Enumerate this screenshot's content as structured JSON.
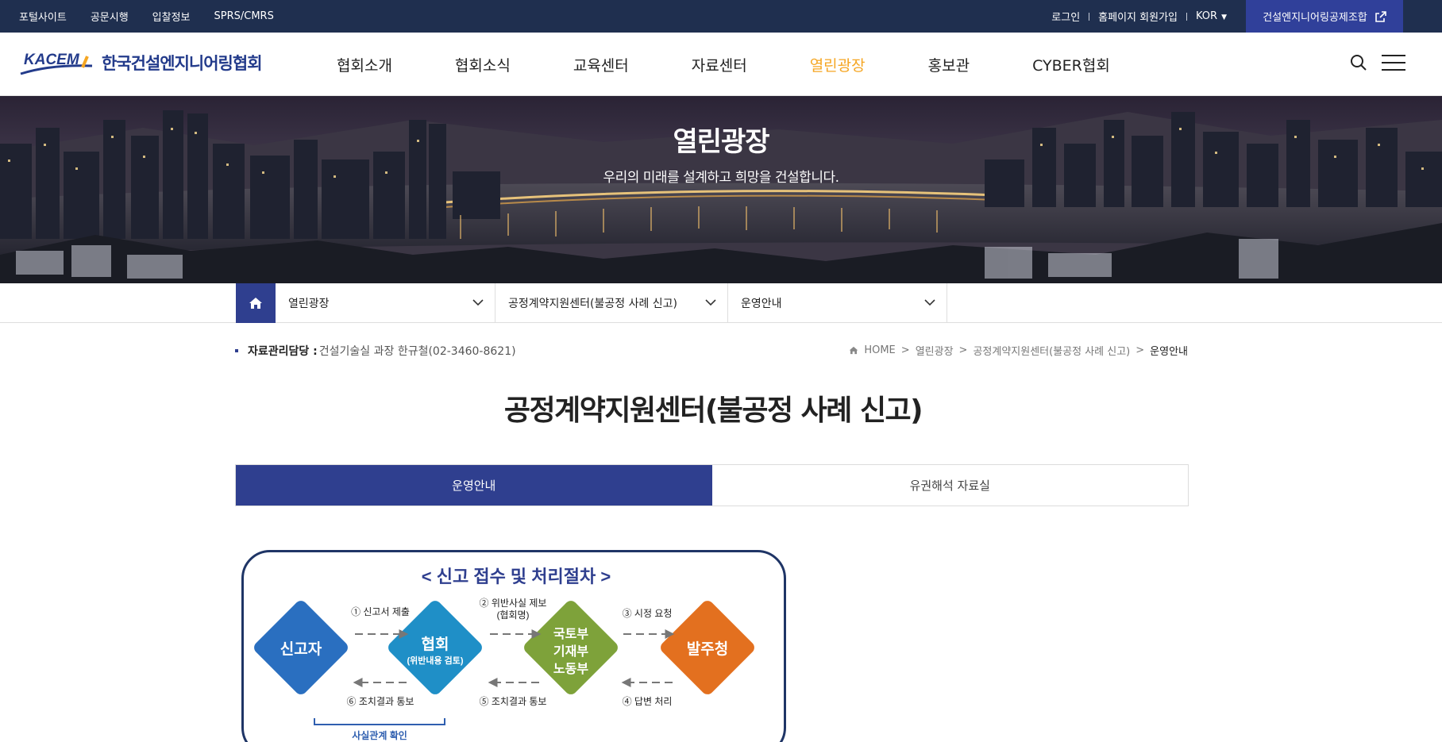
{
  "topbar": {
    "links": [
      "포털사이트",
      "공문시행",
      "입찰정보",
      "SPRS/CMRS"
    ],
    "login": "로그인",
    "join": "홈페이지 회원가입",
    "language": "KOR",
    "cta_label": "건설엔지니어링공제조합"
  },
  "header": {
    "logo_text": "KACEM",
    "logo_name": "한국건설엔지니어링협회",
    "nav": [
      "협회소개",
      "협회소식",
      "교육센터",
      "자료센터",
      "열린광장",
      "홍보관",
      "CYBER협회"
    ],
    "active_nav": "열린광장"
  },
  "hero": {
    "title": "열린광장",
    "subtitle": "우리의 미래를 설계하고 희망을 건설합니다."
  },
  "location": {
    "dropdowns": [
      "열린광장",
      "공정계약지원센터(불공정 사례 신고)",
      "운영안내"
    ]
  },
  "content": {
    "manager_label": "자료관리담당 :",
    "manager_value": "건설기술실 과장 한규철(02-3460-8621)",
    "breadcrumb": [
      "HOME",
      "열린광장",
      "공정계약지원센터(불공정 사례 신고)",
      "운영안내"
    ],
    "page_title": "공정계약지원센터(불공정 사례 신고)",
    "tabs": [
      "운영안내",
      "유권해석 자료실"
    ],
    "active_tab": 0
  },
  "diagram": {
    "title": "< 신고 접수 및 처리절차 >",
    "nodes": [
      {
        "label": "신고자",
        "color": "#2a6fc0"
      },
      {
        "label": "협회",
        "sub": "(위반내용 검토)",
        "color": "#1f8fc7"
      },
      {
        "label_lines": [
          "국토부",
          "기재부",
          "노동부"
        ],
        "color": "#7ea23a"
      },
      {
        "label": "발주청",
        "color": "#e3701f"
      }
    ],
    "forward_steps": [
      "① 신고서 제출",
      "② 위반사실 제보",
      "(협회명)",
      "③ 시정 요청"
    ],
    "backward_steps": [
      "⑥ 조치결과 통보",
      "⑤ 조치결과 통보",
      "④ 답변 처리"
    ],
    "bottom_note": "사실관계 확인"
  },
  "colors": {
    "topbar_bg": "#1f2f4f",
    "accent_blue": "#2f3f8f",
    "nav_active": "#f5a623"
  }
}
